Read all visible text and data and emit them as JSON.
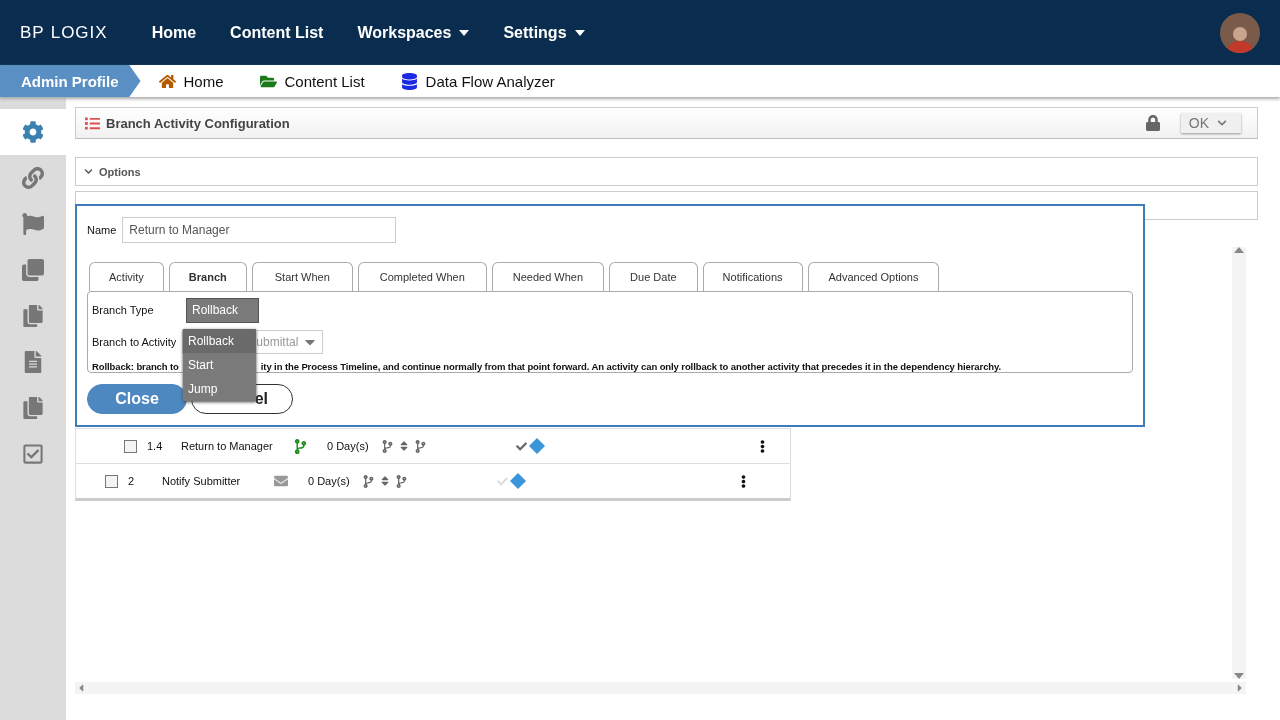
{
  "topnav": {
    "logo_left": "BP",
    "logo_right": "LOGIX",
    "items": [
      {
        "label": "Home",
        "has_menu": false
      },
      {
        "label": "Content List",
        "has_menu": false
      },
      {
        "label": "Workspaces",
        "has_menu": true
      },
      {
        "label": "Settings",
        "has_menu": true
      }
    ]
  },
  "breadcrumb": {
    "profile": "Admin Profile",
    "links": [
      {
        "label": "Home",
        "kind": "home"
      },
      {
        "label": "Content List",
        "kind": "folder"
      },
      {
        "label": "Data Flow Analyzer",
        "kind": "database"
      }
    ]
  },
  "sidebar": [
    {
      "selected": true
    },
    {
      "selected": false
    },
    {
      "selected": false
    },
    {
      "selected": false
    },
    {
      "selected": false
    },
    {
      "selected": false
    },
    {
      "selected": false
    },
    {
      "selected": false
    }
  ],
  "panel": {
    "title": "Branch Activity Configuration",
    "ok_button": "OK",
    "sections": [
      {
        "label": "Options",
        "expanded": true
      }
    ]
  },
  "dialog": {
    "name_label": "Name",
    "name_value": "Return to Manager",
    "tabs": [
      {
        "label": "Activity",
        "selected": false
      },
      {
        "label": "Branch",
        "selected": true
      },
      {
        "label": "Start When",
        "selected": false
      },
      {
        "label": "Completed When",
        "selected": false
      },
      {
        "label": "Needed When",
        "selected": false
      },
      {
        "label": "Due Date",
        "selected": false
      },
      {
        "label": "Notifications",
        "selected": false
      },
      {
        "label": "Advanced Options",
        "selected": false
      }
    ],
    "branch_type_label": "Branch Type",
    "branch_type_value": "Rollback",
    "branch_type_options": [
      {
        "label": "Rollback",
        "selected": true
      },
      {
        "label": "Start",
        "selected": false
      },
      {
        "label": "Jump",
        "selected": false
      }
    ],
    "branch_to_label": "Branch to Activity",
    "branch_to_value": "ubmittal",
    "description_start": "Rollback: branch to",
    "description_end": "ity in the Process Timeline, and continue normally from that point forward. An activity can only rollback to another activity that precedes it in the dependency hierarchy.",
    "close_button": "Close",
    "cancel_button": "el"
  },
  "rows": [
    {
      "nested": true,
      "selected": false,
      "number": "1.4",
      "name": "Return to Manager",
      "kind": "branch",
      "duration": "0 Day(s)",
      "done": true
    },
    {
      "nested": false,
      "selected": false,
      "number": "2",
      "name": "Notify Submitter",
      "kind": "email",
      "duration": "0 Day(s)",
      "done": false
    }
  ]
}
